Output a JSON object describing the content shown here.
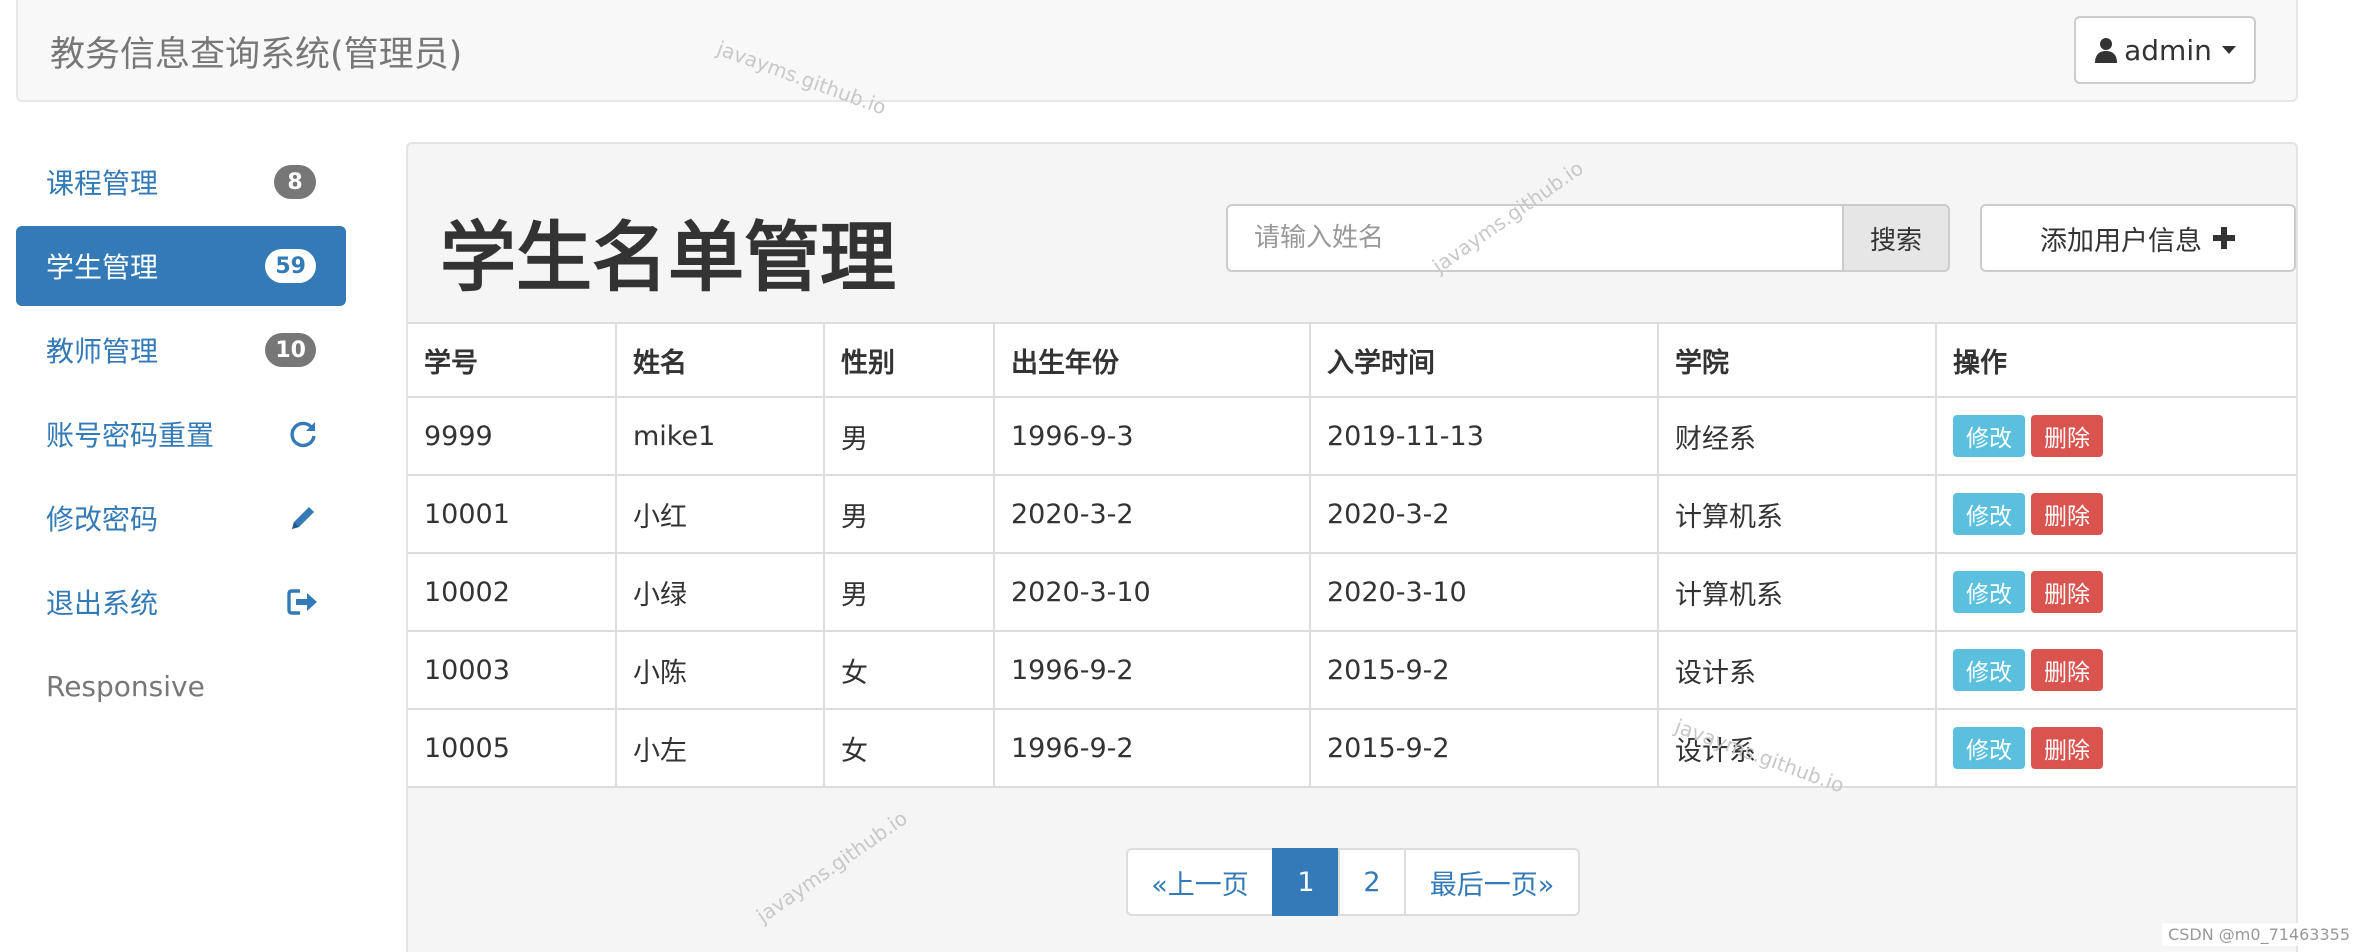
{
  "navbar": {
    "brand": "教务信息查询系统(管理员)",
    "user_label": "admin"
  },
  "sidebar": {
    "items": [
      {
        "label": "课程管理",
        "badge": "8",
        "active": false
      },
      {
        "label": "学生管理",
        "badge": "59",
        "active": true
      },
      {
        "label": "教师管理",
        "badge": "10",
        "active": false
      },
      {
        "label": "账号密码重置",
        "icon": "refresh-icon"
      },
      {
        "label": "修改密码",
        "icon": "pencil-icon"
      },
      {
        "label": "退出系统",
        "icon": "logout-icon"
      },
      {
        "label": "Responsive"
      }
    ]
  },
  "main": {
    "title": "学生名单管理",
    "search": {
      "placeholder": "请输入姓名",
      "button_label": "搜索"
    },
    "add_button_label": "添加用户信息",
    "table": {
      "headers": [
        "学号",
        "姓名",
        "性别",
        "出生年份",
        "入学时间",
        "学院",
        "操作"
      ],
      "rows": [
        [
          "9999",
          "mike1",
          "男",
          "1996-9-3",
          "2019-11-13",
          "财经系"
        ],
        [
          "10001",
          "小红",
          "男",
          "2020-3-2",
          "2020-3-2",
          "计算机系"
        ],
        [
          "10002",
          "小绿",
          "男",
          "2020-3-10",
          "2020-3-10",
          "计算机系"
        ],
        [
          "10003",
          "小陈",
          "女",
          "1996-9-2",
          "2015-9-2",
          "设计系"
        ],
        [
          "10005",
          "小左",
          "女",
          "1996-9-2",
          "2015-9-2",
          "设计系"
        ]
      ],
      "edit_label": "修改",
      "delete_label": "删除"
    },
    "pagination": {
      "prev_label": "«上一页",
      "pages": [
        "1",
        "2"
      ],
      "current_page": "1",
      "last_label": "最后一页»"
    }
  },
  "watermark": "javayms.github.io",
  "credit": "CSDN @m0_71463355",
  "colors": {
    "primary": "#337ab7",
    "info": "#5bc0de",
    "danger": "#d9534f",
    "badge": "#777777"
  }
}
